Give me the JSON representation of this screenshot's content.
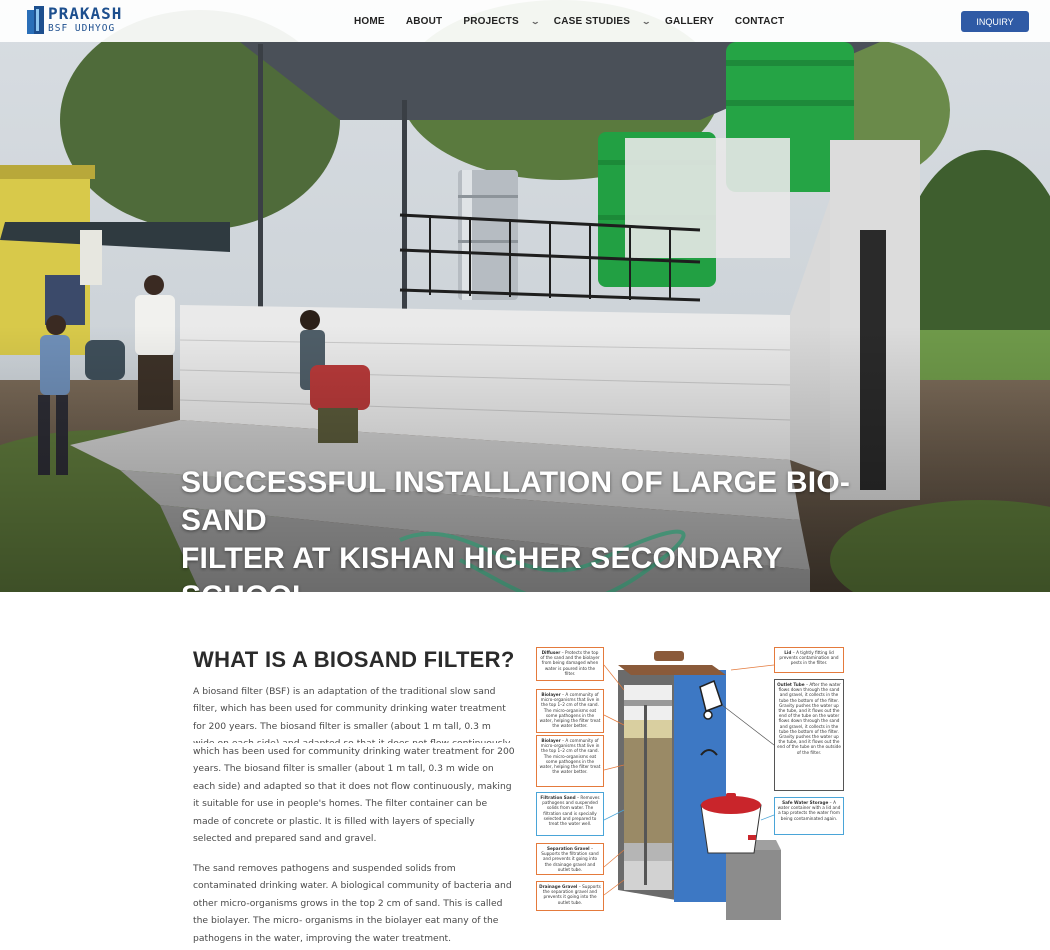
{
  "header": {
    "logo_name": "PRAKASH",
    "logo_sub": "BSF UDHYOG",
    "nav": [
      {
        "label": "HOME",
        "dropdown": false
      },
      {
        "label": "ABOUT",
        "dropdown": false
      },
      {
        "label": "PROJECTS",
        "dropdown": true
      },
      {
        "label": "CASE STUDIES",
        "dropdown": true
      },
      {
        "label": "GALLERY",
        "dropdown": false
      },
      {
        "label": "CONTACT",
        "dropdown": false
      }
    ],
    "cta_label": "INQUIRY"
  },
  "hero": {
    "title_line1": "SUCCESSFUL INSTALLATION OF LARGE BIO-SAND",
    "title_line2": "FILTER AT KISHAN HIGHER SECONDARY SCHOOL."
  },
  "article": {
    "heading": "WHAT IS A BIOSAND FILTER?",
    "p1": "A biosand filter (BSF) is an adaptation of the traditional slow sand filter, which has been used for community drinking water treatment for 200 years. The biosand filter is smaller (about 1 m tall, 0.3 m wide on each side) and adapted so that it does not flow continuously, making it suitable",
    "p2": "which has been used for community drinking water treatment for 200 years. The biosand filter is smaller (about 1 m tall, 0.3 m wide on each side) and adapted so that it does not flow continuously, making it suitable for use in people's homes. The filter container can be made of concrete or plastic. It is filled with layers of specially selected and prepared sand and gravel.",
    "p3": "The sand removes pathogens and suspended solids from contaminated drinking water. A biological community of bacteria and other micro-organisms grows in the top 2 cm of sand. This is called the biolayer. The micro- organisms in the biolayer eat many of the pathogens in the water, improving the water treatment."
  },
  "diagram": {
    "diffuser_title": "Diffuser",
    "diffuser_text": " – Protects the top of the sand and the biolayer from being damaged when water is poured into the filter.",
    "biolayer1_title": "Biolayer",
    "biolayer1_text": " – A community of micro-organisms that live in the top 1–2 cm of the sand. The micro-organisms eat some pathogens in the water, helping the filter treat the water better.",
    "biolayer2_title": "Biolayer",
    "biolayer2_text": " – A community of micro-organisms that live in the top 1–2 cm of the sand. The micro-organisms eat some pathogens in the water, helping the filter treat the water better.",
    "filtration_title": "Filtration Sand",
    "filtration_text": " – Removes pathogens and suspended solids from water. The filtration sand is specially selected and prepared to treat the water well.",
    "separation_title": "Separation Gravel",
    "separation_text": " – Supports the filtration sand and prevents it going into the drainage gravel and outlet tube.",
    "drainage_title": "Drainage Gravel",
    "drainage_text": " – Supports the separation gravel and prevents it going into the outlet tube.",
    "lid_title": "Lid",
    "lid_text": " – A tightly fitting lid prevents contamination and pests in the filter.",
    "outlet_title": "Outlet Tube",
    "outlet_text": " – After the water flows down through the sand and gravel, it collects in the tube the bottom of the filter. Gravity pushes the water up the tube, and it flows out the end of the tube on the water flows down through the sand and gravel, it collects in the tube the bottom of the filter. Gravity pushes the water up the tube, and it flows out the end of the tube on the outside of the filter.",
    "storage_title": "Safe Water Storage",
    "storage_text": " – A water container with a lid and a tap protects the water from being contaminated again."
  }
}
